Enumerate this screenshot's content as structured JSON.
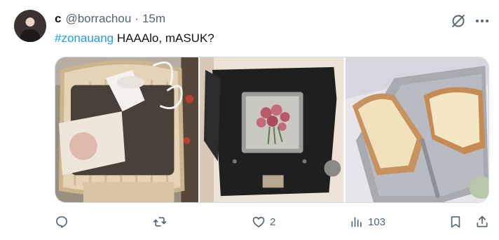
{
  "author": {
    "name": "c",
    "handle": "@borrachou",
    "separator": "·",
    "time": "15m"
  },
  "tweet": {
    "hashtag": "#zonauang",
    "body": " HAAAlo, mASUK?"
  },
  "media": [
    {
      "icon": "photo-basket-teacup"
    },
    {
      "icon": "photo-vintage-camera-flowers"
    },
    {
      "icon": "photo-toast-butter"
    }
  ],
  "actions": {
    "reply_count": "",
    "retweet_count": "",
    "like_count": "2",
    "view_count": "103"
  },
  "colors": {
    "accent": "#1d9bf0",
    "muted": "#536471",
    "text": "#0f1419",
    "border": "#cfd9de"
  }
}
